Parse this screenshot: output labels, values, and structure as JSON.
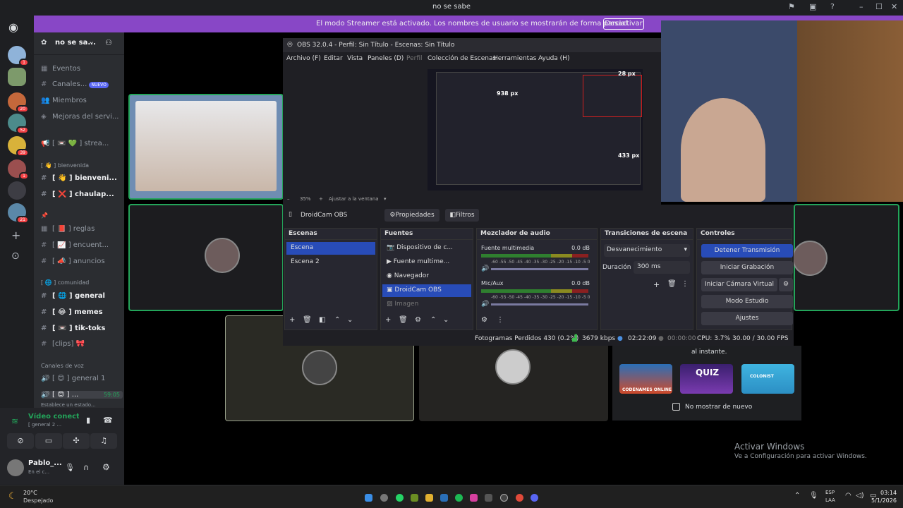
{
  "window": {
    "title": "no se sabe"
  },
  "streamer": {
    "message": "El modo Streamer está activado. Los nombres de usuario se mostrarán de forma parcial.",
    "button": "Desactivar"
  },
  "guilds": [
    {
      "badge": "1"
    },
    {
      "badge": ""
    },
    {
      "badge": "20"
    },
    {
      "badge": "52"
    },
    {
      "badge": "39"
    },
    {
      "badge": "1"
    },
    {
      "badge": ""
    },
    {
      "badge": "21"
    }
  ],
  "server": {
    "name": "no se sa...",
    "chevron": "⌄"
  },
  "channels": {
    "top": [
      {
        "icon": "▦",
        "label": "Eventos"
      },
      {
        "icon": "#",
        "label": "Canales...",
        "badge": "NUEVO"
      },
      {
        "icon": "👥",
        "label": "Miembros"
      },
      {
        "icon": "◈",
        "label": "Mejoras del servi..."
      }
    ],
    "announce": {
      "icon": "📢",
      "label": "[ 📼 💚 ] strea..."
    },
    "cat_bienvenida": "[ 👋 ] bienvenida",
    "bienvenida": [
      {
        "icon": "#",
        "label": "[ 👋 ] bienveni...",
        "bold": true
      },
      {
        "icon": "#",
        "label": "[ ❌ ] chaulap...",
        "bold": true
      }
    ],
    "cat_reglas": "📌",
    "reglas": [
      {
        "icon": "▦",
        "label": "[ 📕 ] reglas"
      },
      {
        "icon": "#",
        "label": "[ 📈 ] encuent..."
      },
      {
        "icon": "#",
        "label": "[ 📣 ] anuncios"
      }
    ],
    "cat_comunidad": "[ 🌐 ] comunidad",
    "comunidad": [
      {
        "icon": "#",
        "label": "[ 🌐 ] general",
        "bold": true
      },
      {
        "icon": "#",
        "label": "[ 😂 ] memes",
        "bold": true
      },
      {
        "icon": "#",
        "label": "[ 📼 ] tik-toks",
        "bold": true
      },
      {
        "icon": "#",
        "label": "[clips] 🎀"
      }
    ],
    "cat_voz": "Canales de voz",
    "voz": [
      {
        "icon": "🔊",
        "label": "[ 😊 ] general 1"
      },
      {
        "icon": "🔊",
        "label": "[ 😊 ] ...",
        "time": "59:05"
      }
    ],
    "status_hint": "Establece un estado..."
  },
  "voice": {
    "status": "Vídeo conectad",
    "channel": "[ general 2 ..."
  },
  "user": {
    "name": "Pablo_...",
    "status": "En el c..."
  },
  "obs": {
    "title": "OBS 32.0.4 - Perfil: Sin Título - Escenas: Sin Título",
    "menu": [
      "Archivo (F)",
      "Editar",
      "Vista",
      "Paneles (D)",
      "Perfil",
      "Colección de Escenas",
      "Herramientas",
      "Ayuda (H)"
    ],
    "preview_labels": [
      "938 px",
      "28 px",
      "433 px"
    ],
    "zoom": "35%",
    "fit": "Ajustar a la ventana",
    "source_name": "DroidCam OBS",
    "props": "Propiedades",
    "filters": "Filtros",
    "docks": {
      "escenas": "Escenas",
      "fuentes": "Fuentes",
      "mezclador": "Mezclador de audio",
      "transiciones": "Transiciones de escena",
      "controles": "Controles"
    },
    "scenes": [
      "Escena",
      "Escena 2"
    ],
    "sources": [
      {
        "icon": "📷",
        "label": "Dispositivo de c..."
      },
      {
        "icon": "▶",
        "label": "Fuente multime..."
      },
      {
        "icon": "◉",
        "label": "Navegador"
      },
      {
        "icon": "▣",
        "label": "DroidCam OBS"
      },
      {
        "icon": "▨",
        "label": "Imagen"
      }
    ],
    "mixer": [
      {
        "name": "Fuente multimedia",
        "db": "0.0 dB"
      },
      {
        "name": "Mic/Aux",
        "db": "0.0 dB"
      }
    ],
    "scale": "-60 -55 -50 -45 -40 -35 -30 -25 -20 -15 -10 -5 0",
    "transition": "Desvanecimiento",
    "duration_label": "Duración",
    "duration": "300 ms",
    "controls": [
      "Detener Transmisión",
      "Iniciar Grabación",
      "Iniciar Cámara Virtual",
      "Modo Estudio",
      "Ajustes"
    ],
    "status": {
      "dropped": "Fotogramas Perdidos 430 (0.2%)",
      "kbps": "3679 kbps",
      "live": "02:22:09",
      "rec": "00:00:00",
      "cpu": "CPU: 3.7%",
      "fps": "30.00 / 30.00 FPS"
    }
  },
  "modal": {
    "text": "al instante.",
    "games": [
      "CODENAMES ONLINE",
      "QUIZ",
      "COLONIST"
    ],
    "checkbox": "No mostrar de nuevo"
  },
  "activate": {
    "title": "Activar Windows",
    "sub": "Ve a Configuración para activar Windows."
  },
  "taskbar": {
    "weather_temp": "20°C",
    "weather_desc": "Despejado",
    "lang1": "ESP",
    "lang2": "LAA",
    "time": "03:14",
    "date": "5/1/2026"
  }
}
